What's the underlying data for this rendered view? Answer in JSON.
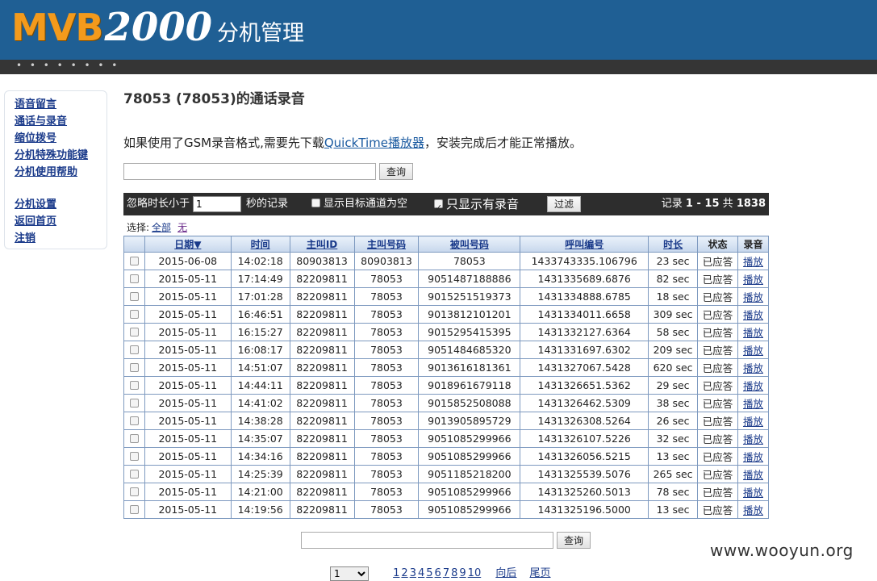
{
  "header": {
    "logo_mvb": "MVB",
    "logo_2000": "2000",
    "logo_sub": "分机管理",
    "dots": "• • • • • • • •"
  },
  "sidebar": {
    "items": [
      {
        "label": "语音留言"
      },
      {
        "label": "通话与录音"
      },
      {
        "label": "缩位拨号"
      },
      {
        "label": "分机特殊功能键"
      },
      {
        "label": "分机使用帮助"
      },
      {
        "label": "分机设置"
      },
      {
        "label": "返回首页"
      },
      {
        "label": "注销"
      }
    ]
  },
  "page": {
    "title": "78053 (78053)的通话录音",
    "notice_prefix": "如果使用了GSM录音格式,需要先下载",
    "notice_link": "QuickTime播放器",
    "notice_suffix": "，安装完成后才能正常播放。",
    "search_button": "查询",
    "search_value": ""
  },
  "filter": {
    "ignore_prefix": "忽略时长小于",
    "ignore_value": "1",
    "ignore_suffix": "秒的记录",
    "show_target_empty_label": "显示目标通道为空",
    "show_target_empty_checked": false,
    "only_recorded_label": "只显示有录音",
    "only_recorded_checked": true,
    "filter_button": "过滤",
    "records_prefix": "记录",
    "records_range": "1 - 15",
    "records_total_prefix": "共",
    "records_total": "1838"
  },
  "select": {
    "label": "选择:",
    "all": "全部",
    "none": "无"
  },
  "table": {
    "headers": {
      "date": "日期▼",
      "time": "时间",
      "caller_id": "主叫ID",
      "caller_number": "主叫号码",
      "callee_number": "被叫号码",
      "call_id": "呼叫编号",
      "duration": "时长",
      "status": "状态",
      "recording": "录音"
    },
    "rows": [
      {
        "date": "2015-06-08",
        "time": "14:02:18",
        "caller_id": "80903813",
        "caller_number": "80903813",
        "callee": "78053",
        "call_id": "1433743335.106796",
        "duration": "23 sec",
        "status": "已应答",
        "play": "播放"
      },
      {
        "date": "2015-05-11",
        "time": "17:14:49",
        "caller_id": "82209811",
        "caller_number": "78053",
        "callee": "9051487188886",
        "call_id": "1431335689.6876",
        "duration": "82 sec",
        "status": "已应答",
        "play": "播放"
      },
      {
        "date": "2015-05-11",
        "time": "17:01:28",
        "caller_id": "82209811",
        "caller_number": "78053",
        "callee": "9015251519373",
        "call_id": "1431334888.6785",
        "duration": "18 sec",
        "status": "已应答",
        "play": "播放"
      },
      {
        "date": "2015-05-11",
        "time": "16:46:51",
        "caller_id": "82209811",
        "caller_number": "78053",
        "callee": "9013812101201",
        "call_id": "1431334011.6658",
        "duration": "309 sec",
        "status": "已应答",
        "play": "播放"
      },
      {
        "date": "2015-05-11",
        "time": "16:15:27",
        "caller_id": "82209811",
        "caller_number": "78053",
        "callee": "9015295415395",
        "call_id": "1431332127.6364",
        "duration": "58 sec",
        "status": "已应答",
        "play": "播放"
      },
      {
        "date": "2015-05-11",
        "time": "16:08:17",
        "caller_id": "82209811",
        "caller_number": "78053",
        "callee": "9051484685320",
        "call_id": "1431331697.6302",
        "duration": "209 sec",
        "status": "已应答",
        "play": "播放"
      },
      {
        "date": "2015-05-11",
        "time": "14:51:07",
        "caller_id": "82209811",
        "caller_number": "78053",
        "callee": "9013616181361",
        "call_id": "1431327067.5428",
        "duration": "620 sec",
        "status": "已应答",
        "play": "播放"
      },
      {
        "date": "2015-05-11",
        "time": "14:44:11",
        "caller_id": "82209811",
        "caller_number": "78053",
        "callee": "9018961679118",
        "call_id": "1431326651.5362",
        "duration": "29 sec",
        "status": "已应答",
        "play": "播放"
      },
      {
        "date": "2015-05-11",
        "time": "14:41:02",
        "caller_id": "82209811",
        "caller_number": "78053",
        "callee": "9015852508088",
        "call_id": "1431326462.5309",
        "duration": "38 sec",
        "status": "已应答",
        "play": "播放"
      },
      {
        "date": "2015-05-11",
        "time": "14:38:28",
        "caller_id": "82209811",
        "caller_number": "78053",
        "callee": "9013905895729",
        "call_id": "1431326308.5264",
        "duration": "26 sec",
        "status": "已应答",
        "play": "播放"
      },
      {
        "date": "2015-05-11",
        "time": "14:35:07",
        "caller_id": "82209811",
        "caller_number": "78053",
        "callee": "9051085299966",
        "call_id": "1431326107.5226",
        "duration": "32 sec",
        "status": "已应答",
        "play": "播放"
      },
      {
        "date": "2015-05-11",
        "time": "14:34:16",
        "caller_id": "82209811",
        "caller_number": "78053",
        "callee": "9051085299966",
        "call_id": "1431326056.5215",
        "duration": "13 sec",
        "status": "已应答",
        "play": "播放"
      },
      {
        "date": "2015-05-11",
        "time": "14:25:39",
        "caller_id": "82209811",
        "caller_number": "78053",
        "callee": "9051185218200",
        "call_id": "1431325539.5076",
        "duration": "265 sec",
        "status": "已应答",
        "play": "播放"
      },
      {
        "date": "2015-05-11",
        "time": "14:21:00",
        "caller_id": "82209811",
        "caller_number": "78053",
        "callee": "9051085299966",
        "call_id": "1431325260.5013",
        "duration": "78 sec",
        "status": "已应答",
        "play": "播放"
      },
      {
        "date": "2015-05-11",
        "time": "14:19:56",
        "caller_id": "82209811",
        "caller_number": "78053",
        "callee": "9051085299966",
        "call_id": "1431325196.5000",
        "duration": "13 sec",
        "status": "已应答",
        "play": "播放"
      }
    ]
  },
  "pager": {
    "selected_page": "1",
    "pages": [
      "1",
      "2",
      "3",
      "4",
      "5",
      "6",
      "7",
      "8",
      "9",
      "10"
    ],
    "next": "向后",
    "last": "尾页"
  },
  "watermark": "www.wooyun.org"
}
